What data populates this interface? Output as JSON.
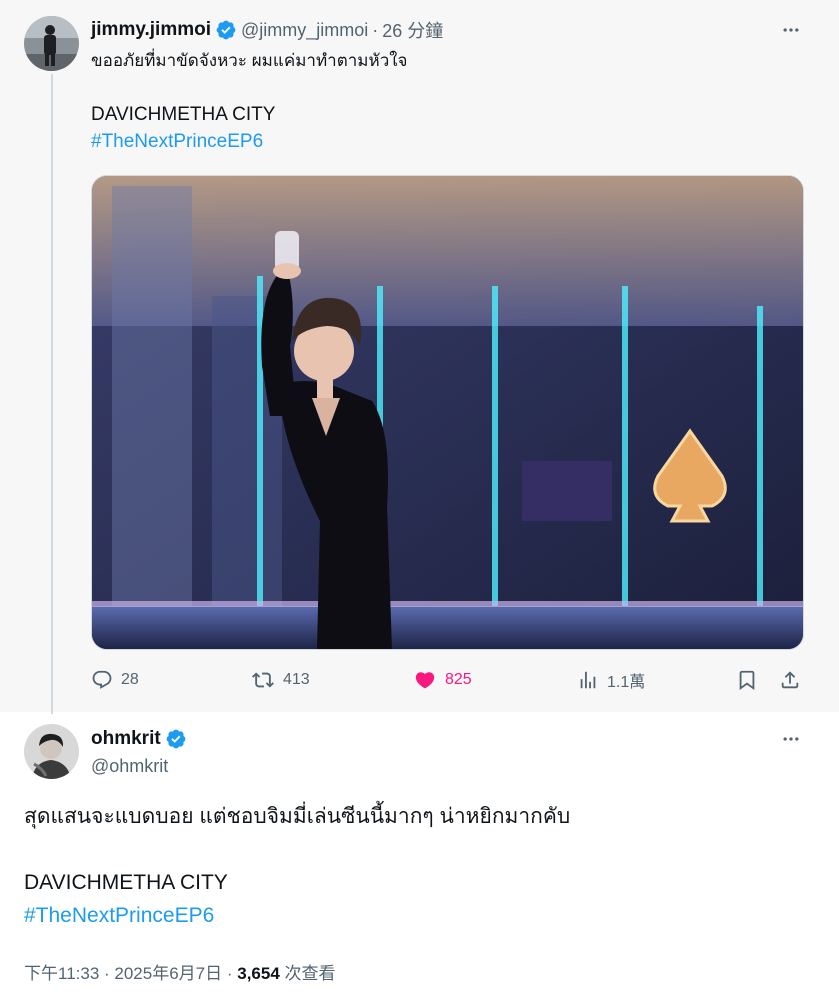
{
  "parent_tweet": {
    "display_name": "jimmy.jimmoi",
    "handle": "@jimmy_jimmoi",
    "separator": "·",
    "time_ago": "26 分鐘",
    "text": "ขออภัยที่มาขัดจังหวะ ผมแค่มาทำตามหัวใจ",
    "title_line": "DAVICHMETHA CITY",
    "hashtag": "#TheNextPrinceEP6",
    "stats": {
      "replies": "28",
      "retweets": "413",
      "likes": "825",
      "views": "1.1萬"
    }
  },
  "reply_tweet": {
    "display_name": "ohmkrit",
    "handle": "@ohmkrit",
    "text": "สุดแสนจะแบดบอย แต่ชอบจิมมี่เล่นซีนนี้มากๆ น่าหยิกมากคับ",
    "title_line": "DAVICHMETHA CITY",
    "hashtag": "#TheNextPrinceEP6",
    "timestamp": "下午11:33 · 2025年6月7日 · ",
    "view_count": "3,654",
    "view_label": " 次查看"
  },
  "colors": {
    "accent": "#1d9bf0",
    "like": "#f91880",
    "muted": "#536471",
    "thread_line": "#cfd9de",
    "parent_bg": "#f7f7f7"
  },
  "icons": [
    "verified-icon",
    "more-icon",
    "reply-icon",
    "retweet-icon",
    "heart-icon",
    "views-icon",
    "bookmark-icon",
    "share-icon"
  ]
}
